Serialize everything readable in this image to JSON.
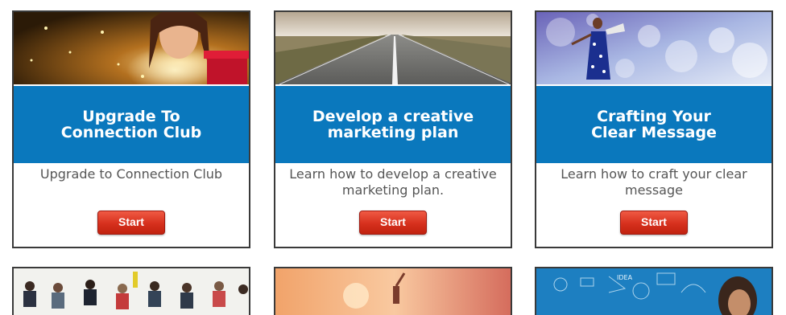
{
  "cards": [
    {
      "title": "Upgrade To\nConnection Club",
      "description": "Upgrade to Connection Club",
      "button_label": "Start",
      "image": "woman-opening-glowing-gift"
    },
    {
      "title": "Develop a creative\nmarketing plan",
      "description": "Learn how to develop a creative marketing plan.",
      "button_label": "Start",
      "image": "open-road-horizon"
    },
    {
      "title": "Crafting Your\nClear Message",
      "description": "Learn how to craft your clear message",
      "button_label": "Start",
      "image": "woman-with-megaphone-bokeh"
    }
  ],
  "partial_cards": [
    {
      "image": "audience-crowd"
    },
    {
      "image": "person-jumping-sunset"
    },
    {
      "image": "woman-idea-sketch-blue"
    }
  ],
  "colors": {
    "band_blue": "#0a78bd",
    "button_red": "#d6301d",
    "border": "#3a3a3a",
    "desc_text": "#555555"
  }
}
